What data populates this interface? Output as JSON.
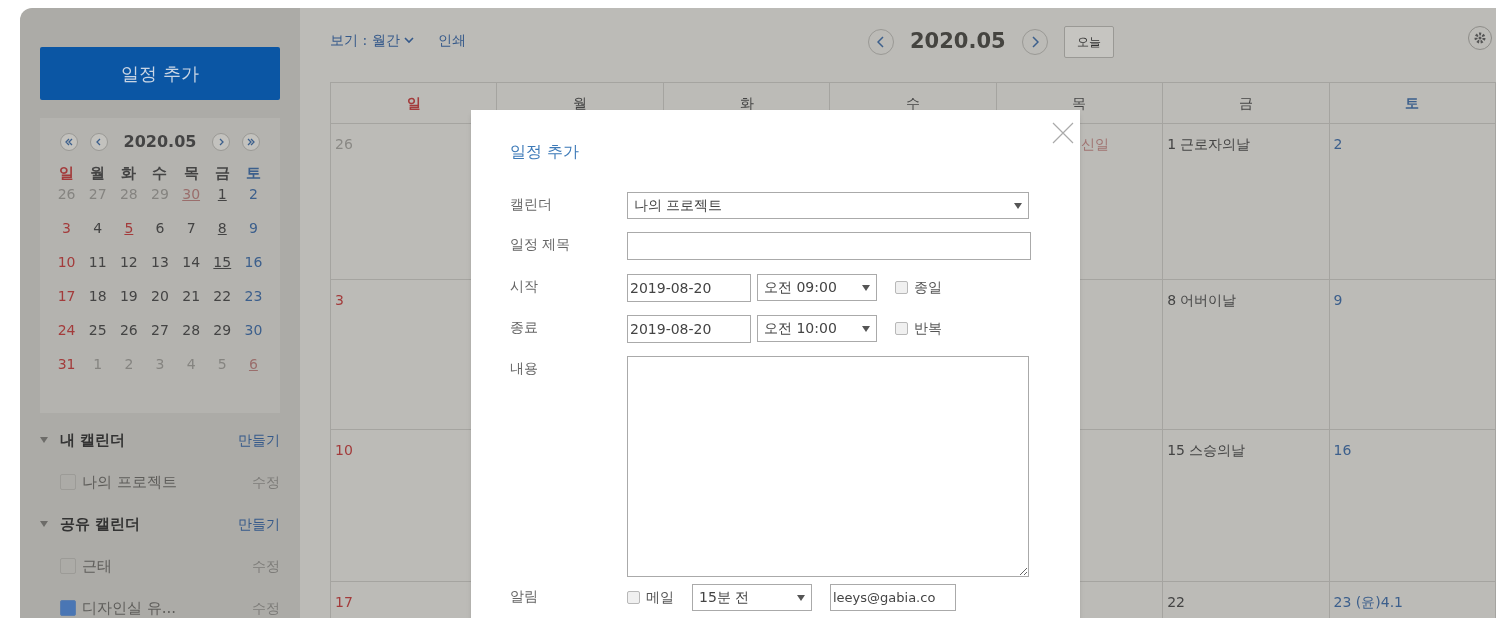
{
  "sidebar": {
    "add_button": "일정 추가",
    "mini_calendar": {
      "month": "2020.05",
      "weekdays": [
        "일",
        "월",
        "화",
        "수",
        "목",
        "금",
        "토"
      ],
      "weeks": [
        [
          {
            "d": "26",
            "muted": true,
            "underlined": false
          },
          {
            "d": "27",
            "muted": true,
            "underlined": false
          },
          {
            "d": "28",
            "muted": true,
            "underlined": false
          },
          {
            "d": "29",
            "muted": true,
            "underlined": false
          },
          {
            "d": "30",
            "muted": true,
            "holiday": true,
            "underlined": true
          },
          {
            "d": "1",
            "muted": false,
            "underlined": true
          },
          {
            "d": "2",
            "muted": false,
            "underlined": false
          }
        ],
        [
          {
            "d": "3",
            "muted": false,
            "underlined": false
          },
          {
            "d": "4",
            "muted": false,
            "underlined": false
          },
          {
            "d": "5",
            "muted": false,
            "holiday": true,
            "underlined": true
          },
          {
            "d": "6",
            "muted": false,
            "underlined": false
          },
          {
            "d": "7",
            "muted": false,
            "underlined": false
          },
          {
            "d": "8",
            "muted": false,
            "underlined": true
          },
          {
            "d": "9",
            "muted": false,
            "underlined": false
          }
        ],
        [
          {
            "d": "10",
            "muted": false,
            "underlined": false
          },
          {
            "d": "11",
            "muted": false,
            "underlined": false
          },
          {
            "d": "12",
            "muted": false,
            "underlined": false
          },
          {
            "d": "13",
            "muted": false,
            "underlined": false
          },
          {
            "d": "14",
            "muted": false,
            "underlined": false
          },
          {
            "d": "15",
            "muted": false,
            "underlined": true
          },
          {
            "d": "16",
            "muted": false,
            "underlined": false
          }
        ],
        [
          {
            "d": "17",
            "muted": false,
            "underlined": false
          },
          {
            "d": "18",
            "muted": false,
            "underlined": false
          },
          {
            "d": "19",
            "muted": false,
            "underlined": false
          },
          {
            "d": "20",
            "muted": false,
            "underlined": false
          },
          {
            "d": "21",
            "muted": false,
            "underlined": false
          },
          {
            "d": "22",
            "muted": false,
            "underlined": false
          },
          {
            "d": "23",
            "muted": false,
            "underlined": false
          }
        ],
        [
          {
            "d": "24",
            "muted": false,
            "underlined": false
          },
          {
            "d": "25",
            "muted": false,
            "underlined": false
          },
          {
            "d": "26",
            "muted": false,
            "underlined": false
          },
          {
            "d": "27",
            "muted": false,
            "underlined": false
          },
          {
            "d": "28",
            "muted": false,
            "underlined": false
          },
          {
            "d": "29",
            "muted": false,
            "underlined": false
          },
          {
            "d": "30",
            "muted": false,
            "underlined": false
          }
        ],
        [
          {
            "d": "31",
            "muted": false,
            "underlined": false
          },
          {
            "d": "1",
            "muted": true,
            "underlined": false
          },
          {
            "d": "2",
            "muted": true,
            "underlined": false
          },
          {
            "d": "3",
            "muted": true,
            "underlined": false
          },
          {
            "d": "4",
            "muted": true,
            "underlined": false
          },
          {
            "d": "5",
            "muted": true,
            "underlined": false
          },
          {
            "d": "6",
            "muted": true,
            "holiday": true,
            "underlined": true
          }
        ]
      ]
    },
    "sections": [
      {
        "title": "내 캘린더",
        "action": "만들기",
        "expanded": true,
        "items": [
          {
            "name": "나의 프로젝트",
            "checked": false,
            "action": "수정"
          }
        ]
      },
      {
        "title": "공유 캘린더",
        "action": "만들기",
        "expanded": true,
        "items": [
          {
            "name": "근태",
            "checked": false,
            "action": "수정"
          },
          {
            "name": "디자인실 유...",
            "checked": true,
            "action": "수정"
          }
        ]
      }
    ]
  },
  "toolbar": {
    "view": "보기 : 월간",
    "print": "인쇄",
    "month": "2020.05",
    "today": "오늘"
  },
  "calendar": {
    "weekdays": [
      "일",
      "월",
      "화",
      "수",
      "목",
      "금",
      "토"
    ],
    "weeks": [
      [
        {
          "kind": "date",
          "text": "26",
          "muted": true
        },
        {
          "kind": "empty"
        },
        {
          "kind": "empty"
        },
        {
          "kind": "empty"
        },
        {
          "kind": "fragment",
          "text": "신일",
          "muted": true,
          "holiday": true
        },
        {
          "kind": "date",
          "text": "1 근로자의날",
          "muted": false
        },
        {
          "kind": "date",
          "text": "2",
          "muted": false
        }
      ],
      [
        {
          "kind": "date",
          "text": "3",
          "muted": false
        },
        {
          "kind": "empty"
        },
        {
          "kind": "empty"
        },
        {
          "kind": "empty"
        },
        {
          "kind": "empty"
        },
        {
          "kind": "date",
          "text": "8 어버이날",
          "muted": false
        },
        {
          "kind": "date",
          "text": "9",
          "muted": false
        }
      ],
      [
        {
          "kind": "date",
          "text": "10",
          "muted": false
        },
        {
          "kind": "empty"
        },
        {
          "kind": "empty"
        },
        {
          "kind": "empty"
        },
        {
          "kind": "empty"
        },
        {
          "kind": "date",
          "text": "15 스승의날",
          "muted": false
        },
        {
          "kind": "date",
          "text": "16",
          "muted": false
        }
      ],
      [
        {
          "kind": "date",
          "text": "17",
          "muted": false
        },
        {
          "kind": "empty"
        },
        {
          "kind": "empty"
        },
        {
          "kind": "empty"
        },
        {
          "kind": "empty"
        },
        {
          "kind": "date",
          "text": "22",
          "muted": false
        },
        {
          "kind": "date",
          "text": "23 (윤)4.1",
          "muted": false
        }
      ]
    ]
  },
  "dialog": {
    "title": "일정 추가",
    "rows": [
      {
        "kind": "select",
        "label": "캘린더",
        "value": "나의 프로젝트"
      },
      {
        "kind": "text",
        "label": "일정 제목"
      },
      {
        "kind": "datetime",
        "label": "시작",
        "date": "2019-08-20",
        "time": "오전 09:00",
        "option": {
          "label": "종일",
          "checked": false
        }
      },
      {
        "kind": "datetime",
        "label": "종료",
        "date": "2019-08-20",
        "time": "오전 10:00",
        "option": {
          "label": "반복",
          "checked": false
        }
      },
      {
        "kind": "textarea",
        "label": "내용"
      },
      {
        "kind": "alarm",
        "label": "알림",
        "option": {
          "label": "메일",
          "checked": false
        },
        "before": "15분 전",
        "email": "leeys@gabia.co"
      }
    ]
  }
}
